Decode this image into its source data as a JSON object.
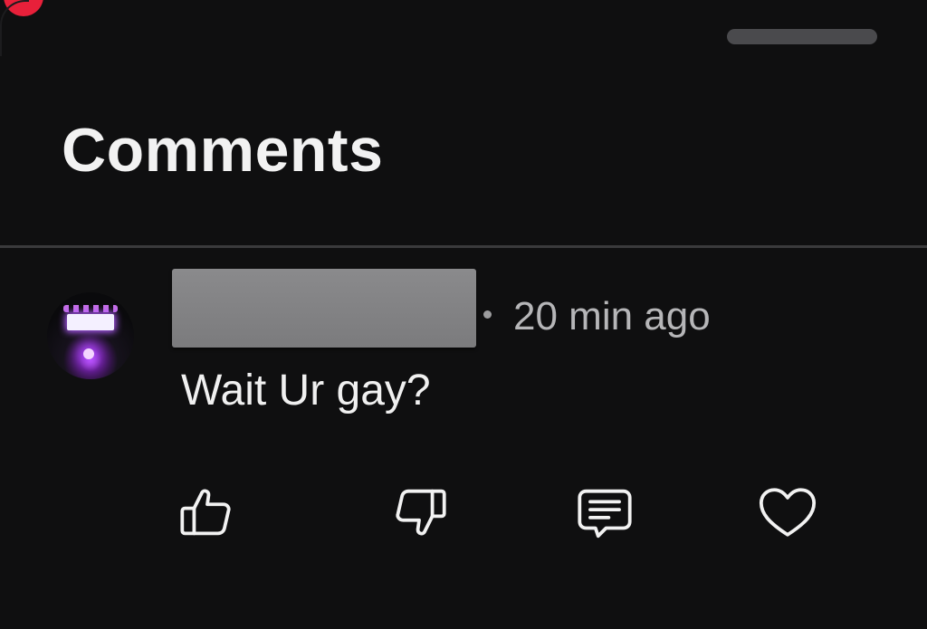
{
  "header": {
    "title": "Comments"
  },
  "comment": {
    "username": "",
    "timestamp": "20 min ago",
    "text": "Wait Ur gay?"
  },
  "actions": {
    "icons": [
      "thumbs-up-icon",
      "thumbs-down-icon",
      "reply-icon",
      "heart-icon"
    ]
  },
  "colors": {
    "background": "#0f0f10",
    "notification_dot": "#e8203a",
    "text_primary": "#f2f2f2",
    "text_secondary": "#b6b6b8",
    "divider": "#3a3a3c",
    "redaction": "#808082"
  }
}
